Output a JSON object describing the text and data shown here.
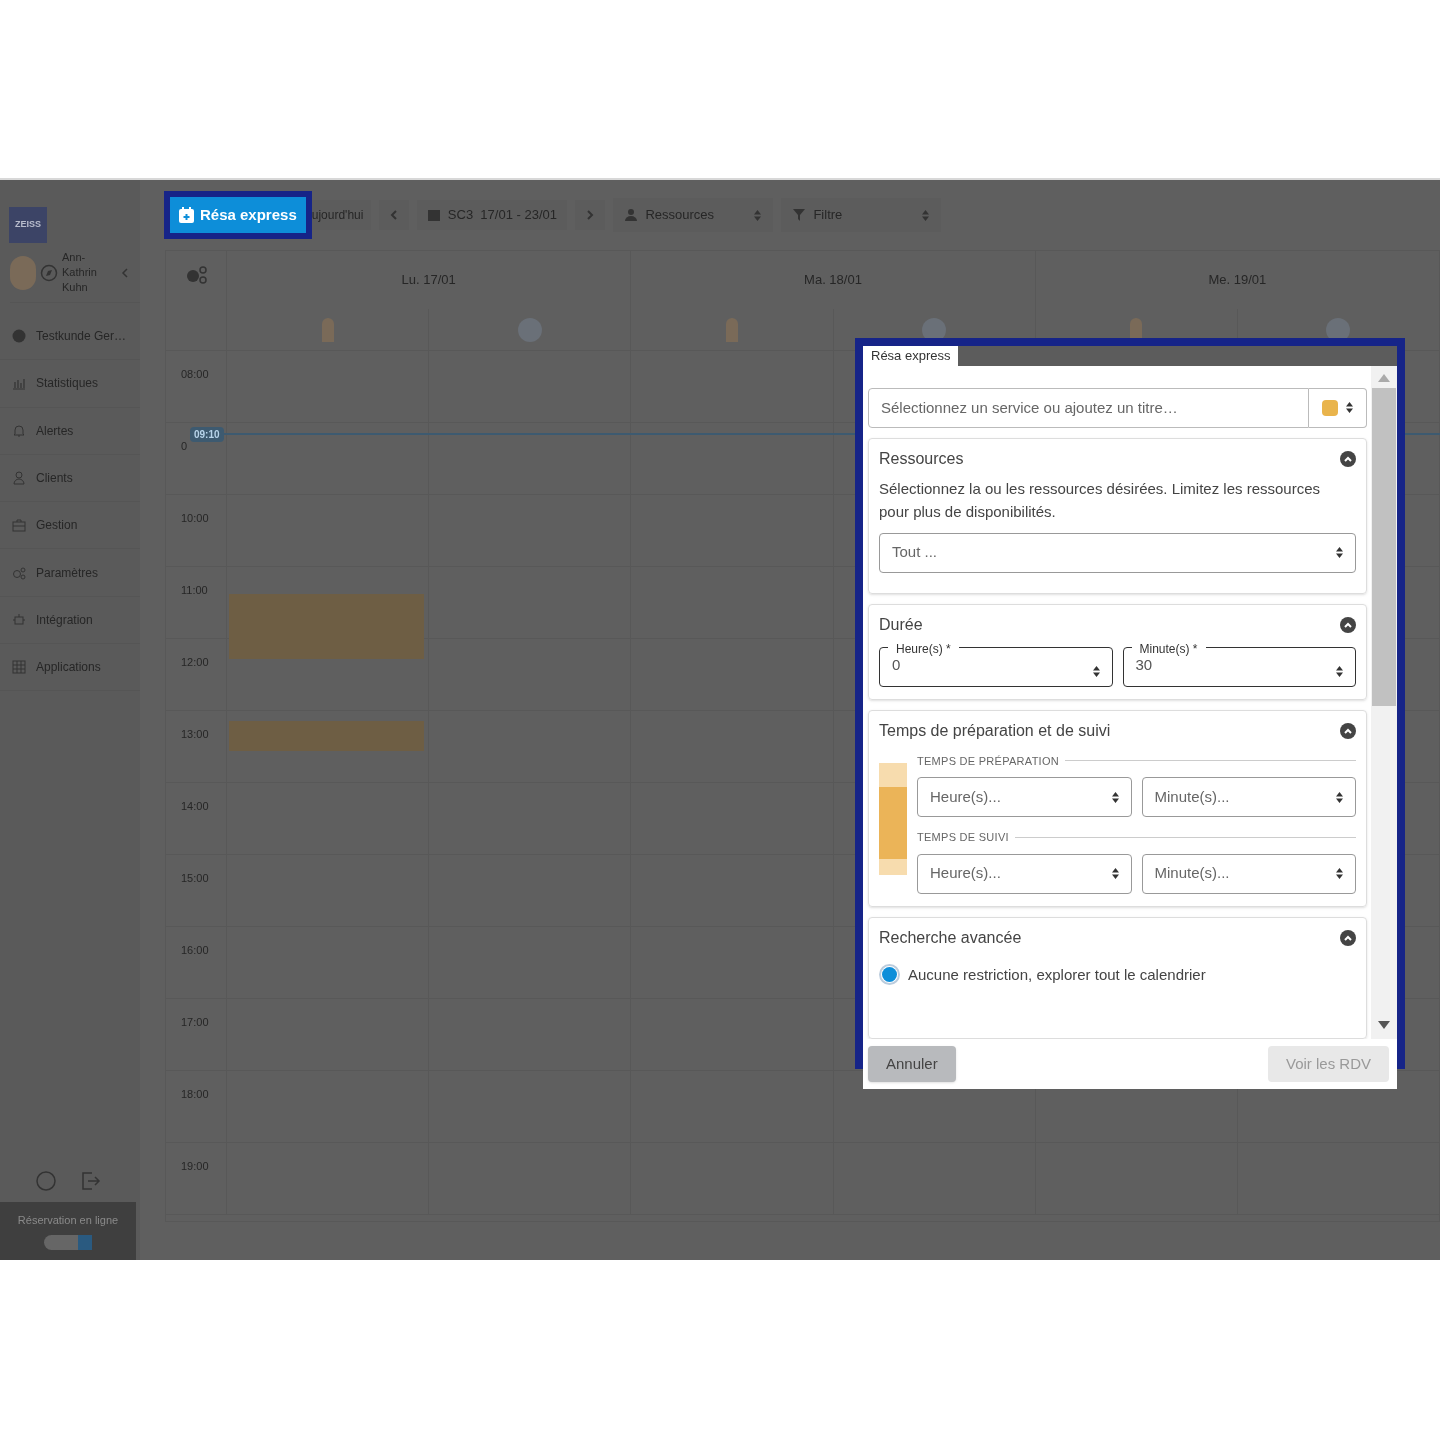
{
  "sidebar": {
    "logo": "ZEISS",
    "user": "Ann-Kathrin Kuhn",
    "items": [
      {
        "label": "Testkunde Ger…",
        "kind": "account"
      },
      {
        "label": "Statistiques",
        "kind": "chart"
      },
      {
        "label": "Alertes",
        "kind": "bell"
      },
      {
        "label": "Clients",
        "kind": "person"
      },
      {
        "label": "Gestion",
        "kind": "briefcase"
      },
      {
        "label": "Paramètres",
        "kind": "gears"
      },
      {
        "label": "Intégration",
        "kind": "plug"
      },
      {
        "label": "Applications",
        "kind": "grid"
      }
    ],
    "online_booking": {
      "label": "Réservation en ligne",
      "on": true
    }
  },
  "toolbar": {
    "express_button": "Résa express",
    "today": "ujourd'hui",
    "week": "SC3  17/01 - 23/01",
    "resources": "Ressources",
    "filter": "Filtre"
  },
  "calendar": {
    "days": [
      "Lu. 17/01",
      "Ma. 18/01",
      "Me. 19/01"
    ],
    "hours": [
      "08:00",
      "0",
      "10:00",
      "11:00",
      "12:00",
      "13:00",
      "14:00",
      "15:00",
      "16:00",
      "17:00",
      "18:00",
      "19:00"
    ],
    "now_marker": "09:10",
    "resource_avatars": [
      {
        "kind": "photo"
      },
      {
        "kind": "initials"
      },
      {
        "kind": "photo"
      },
      {
        "kind": "initials"
      },
      {
        "kind": "photo"
      },
      {
        "kind": "initials"
      }
    ]
  },
  "dialog": {
    "tab": "Résa express",
    "service_placeholder": "Sélectionnez un service ou ajoutez un titre…",
    "color": "#e9b44c",
    "sections": [
      {
        "kind": "resources",
        "title": "Ressources",
        "expanded": true,
        "description": "Sélectionnez la ou les ressources désirées. Limitez les ressources pour plus de disponibilités.",
        "select": "Tout ..."
      },
      {
        "kind": "duration",
        "title": "Durée",
        "expanded": true,
        "hours_label": "Heure(s) *",
        "hours": "0",
        "minutes_label": "Minute(s) *",
        "minutes": "30"
      },
      {
        "kind": "buffers",
        "title": "Temps de préparation et de suivi",
        "expanded": true,
        "groups": [
          {
            "label": "TEMPS DE PRÉPARATION",
            "hours_placeholder": "Heure(s)...",
            "minutes_placeholder": "Minute(s)..."
          },
          {
            "label": "TEMPS DE SUIVI",
            "hours_placeholder": "Heure(s)...",
            "minutes_placeholder": "Minute(s)..."
          }
        ]
      },
      {
        "kind": "search",
        "title": "Recherche avancée",
        "expanded": true,
        "options": [
          {
            "label": "Aucune restriction, explorer tout le calendrier",
            "selected": true
          }
        ]
      }
    ],
    "cancel": "Annuler",
    "submit": {
      "label": "Voir les RDV",
      "disabled": true
    }
  }
}
